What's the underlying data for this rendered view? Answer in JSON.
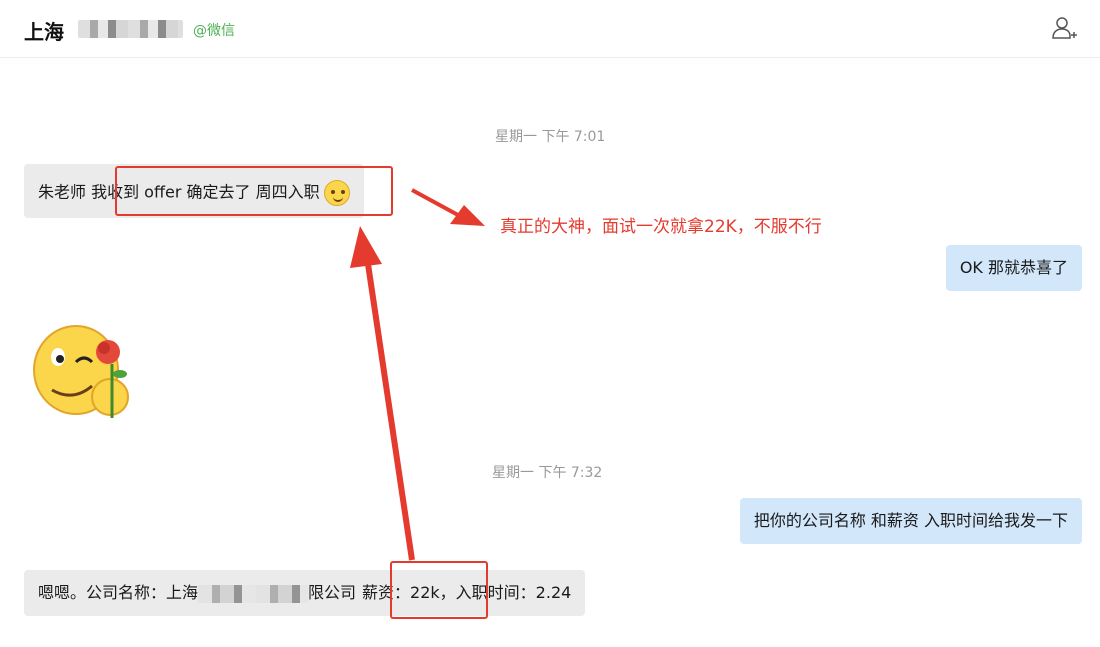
{
  "header": {
    "title": "上海",
    "source": "@微信",
    "add_user_icon": "add-user-icon"
  },
  "messages": {
    "timestamp1": "星期一 下午 7:01",
    "msg1_part1": "朱老师 我",
    "msg1_part2": "收到 offer 确定去了 周四入职",
    "msg1_emoji": "smile-emoji",
    "reply1": "OK 那就恭喜了",
    "sticker": "emoji-sticker-with-rose",
    "timestamp2": "星期一 下午 7:32",
    "reply2": "把你的公司名称 和薪资 入职时间给我发一下",
    "msg2_prefix": "嗯嗯。公司名称：上海",
    "msg2_company_suffix": "限公司",
    "msg2_salary": "薪资：22k",
    "msg2_rest": "，入职时间：2.24"
  },
  "annotation": {
    "text": "真正的大神，面试一次就拿22K，不服不行",
    "color": "#e53a2e"
  }
}
